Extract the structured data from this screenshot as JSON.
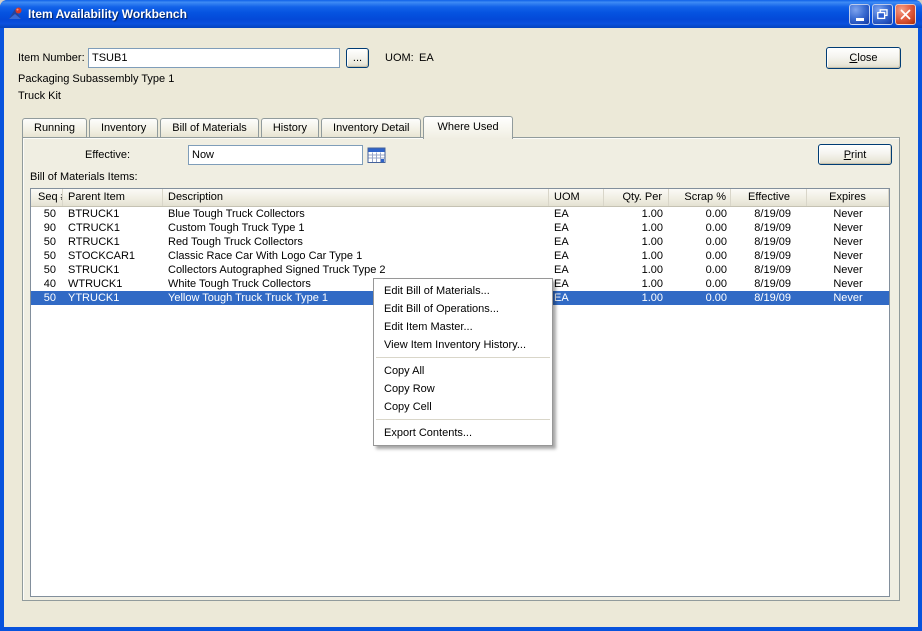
{
  "colors": {
    "selection": "#316AC5",
    "window_border": "#0853DD",
    "client_background": "#ECE9D8"
  },
  "titlebar": {
    "title": "Item Availability Workbench"
  },
  "header": {
    "item_number_label": "Item Number:",
    "item_number_value": "TSUB1",
    "browse_button_label": "...",
    "uom_label": "UOM:",
    "uom_value": "EA",
    "close_button_label": "Close",
    "item_description_line1": "Packaging Subassembly Type 1",
    "item_description_line2": "Truck Kit"
  },
  "tabs": {
    "items": [
      "Running",
      "Inventory",
      "Bill of Materials",
      "History",
      "Inventory Detail",
      "Where Used"
    ],
    "active_index": 5
  },
  "where_used": {
    "effective_label": "Effective:",
    "effective_value": "Now",
    "print_button_label": "Print",
    "grid_label": "Bill of Materials Items:"
  },
  "grid": {
    "columns": [
      "Seq #",
      "Parent Item",
      "Description",
      "UOM",
      "Qty. Per",
      "Scrap %",
      "Effective",
      "Expires"
    ],
    "rows": [
      [
        "50",
        "BTRUCK1",
        "Blue Tough Truck Collectors",
        "EA",
        "1.00",
        "0.00",
        "8/19/09",
        "Never"
      ],
      [
        "90",
        "CTRUCK1",
        "Custom Tough Truck Type 1",
        "EA",
        "1.00",
        "0.00",
        "8/19/09",
        "Never"
      ],
      [
        "50",
        "RTRUCK1",
        "Red Tough Truck Collectors",
        "EA",
        "1.00",
        "0.00",
        "8/19/09",
        "Never"
      ],
      [
        "50",
        "STOCKCAR1",
        "Classic Race Car With Logo Car Type 1",
        "EA",
        "1.00",
        "0.00",
        "8/19/09",
        "Never"
      ],
      [
        "50",
        "STRUCK1",
        "Collectors Autographed Signed Truck Type 2",
        "EA",
        "1.00",
        "0.00",
        "8/19/09",
        "Never"
      ],
      [
        "40",
        "WTRUCK1",
        "White Tough Truck Collectors",
        "EA",
        "1.00",
        "0.00",
        "8/19/09",
        "Never"
      ],
      [
        "50",
        "YTRUCK1",
        "Yellow Tough Truck Truck Type 1",
        "EA",
        "1.00",
        "0.00",
        "8/19/09",
        "Never"
      ]
    ],
    "selected_row_index": 6
  },
  "context_menu": {
    "items": [
      {
        "type": "item",
        "label": "Edit Bill of Materials..."
      },
      {
        "type": "item",
        "label": "Edit Bill of Operations..."
      },
      {
        "type": "item",
        "label": "Edit Item Master..."
      },
      {
        "type": "item",
        "label": "View Item Inventory History..."
      },
      {
        "type": "separator"
      },
      {
        "type": "item",
        "label": "Copy All"
      },
      {
        "type": "item",
        "label": "Copy Row"
      },
      {
        "type": "item",
        "label": "Copy Cell"
      },
      {
        "type": "separator"
      },
      {
        "type": "item",
        "label": "Export Contents..."
      }
    ]
  }
}
